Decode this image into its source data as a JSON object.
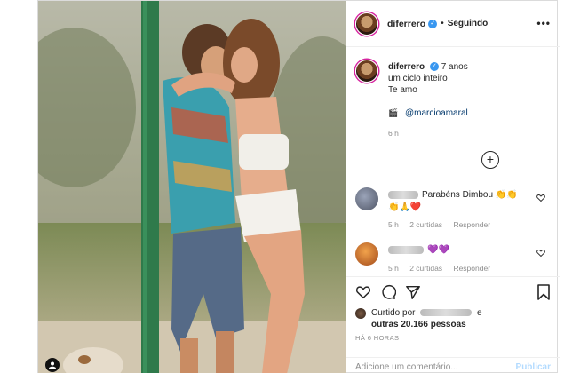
{
  "header": {
    "username": "diferrero",
    "separator": "•",
    "follow_status": "Seguindo",
    "more_icon": "more-horizontal-icon"
  },
  "caption": {
    "username": "diferrero",
    "time_ago": "7 anos",
    "line1": "um ciclo inteiro",
    "line2": "Te amo",
    "credit_icon": "🎬",
    "credit_mention": "@marcioamaral",
    "timestamp": "6 h"
  },
  "load_more_icon": "plus-circle-icon",
  "comments": [
    {
      "text": "Parabéns Dimbou 👏👏",
      "text2": "👏🙏❤️",
      "time": "5 h",
      "likes": "2 curtidas",
      "reply": "Responder"
    },
    {
      "text": "💜💜",
      "time": "5 h",
      "likes": "2 curtidas",
      "reply": "Responder"
    }
  ],
  "likes": {
    "prefix": "Curtido por",
    "suffix": "e",
    "others": "outras 20.166 pessoas"
  },
  "post_time": "HÁ 6 HORAS",
  "add_comment": {
    "placeholder": "Adicione um comentário...",
    "publish": "Publicar"
  },
  "colors": {
    "link": "#00376b",
    "verified": "#3897f0",
    "muted": "#8e8e8e",
    "publish_disabled": "#b3dbff"
  }
}
